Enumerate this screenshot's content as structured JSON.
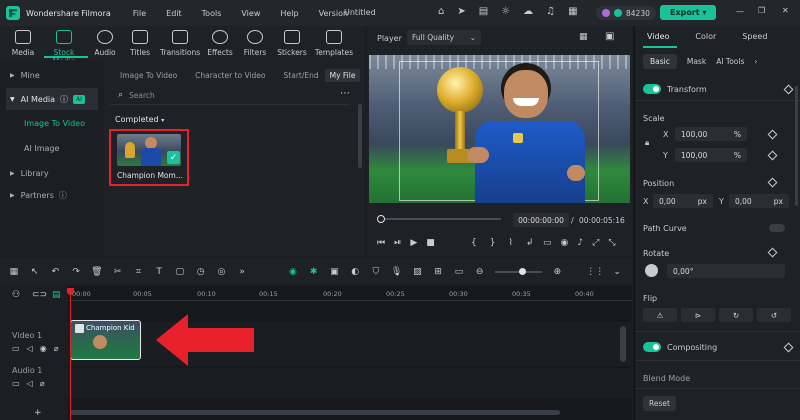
{
  "app": {
    "name": "Wondershare Filmora",
    "document": "Untitled",
    "credits": "84230",
    "export_label": "Export",
    "menu": [
      "File",
      "Edit",
      "Tools",
      "View",
      "Help",
      "Version"
    ]
  },
  "media_tabs": [
    {
      "label": "Media",
      "icon": "media-icon"
    },
    {
      "label": "Stock Media",
      "icon": "stock-media-icon"
    },
    {
      "label": "Audio",
      "icon": "audio-icon"
    },
    {
      "label": "Titles",
      "icon": "titles-icon"
    },
    {
      "label": "Transitions",
      "icon": "transitions-icon"
    },
    {
      "label": "Effects",
      "icon": "effects-icon"
    },
    {
      "label": "Filters",
      "icon": "filters-icon"
    },
    {
      "label": "Stickers",
      "icon": "stickers-icon"
    },
    {
      "label": "Templates",
      "icon": "templates-icon"
    }
  ],
  "sidebar": {
    "mine": "Mine",
    "ai_media": "AI Media",
    "ai_badge": "AI",
    "image_to_video": "Image To Video",
    "ai_image": "AI Image",
    "library": "Library",
    "partners": "Partners"
  },
  "ai_tabs": [
    "Image To Video",
    "Character to Video",
    "Start/End",
    "My File"
  ],
  "search_placeholder": "Search",
  "completed_label": "Completed",
  "media_item": {
    "name": "Champion Mom..."
  },
  "player": {
    "label": "Player",
    "quality": "Full Quality",
    "current_time": "00:00:00:00",
    "separator": "/",
    "total_time": "00:00:05:16"
  },
  "timeline": {
    "ruler": [
      "00:00",
      "00:05",
      "00:10",
      "00:15",
      "00:20",
      "00:25",
      "00:30",
      "00:35",
      "00:40"
    ],
    "video_track": "Video 1",
    "audio_track": "Audio 1",
    "clip_label": "Champion Kid"
  },
  "right": {
    "tabs": [
      "Video",
      "Color",
      "Speed"
    ],
    "subtabs": [
      "Basic",
      "Mask",
      "AI Tools"
    ],
    "transform": "Transform",
    "scale": "Scale",
    "x_label": "X",
    "y_label": "Y",
    "scale_x": "100,00",
    "scale_y": "100,00",
    "pct": "%",
    "position": "Position",
    "pos_x": "0,00",
    "pos_y": "0,00",
    "px": "px",
    "path_curve": "Path Curve",
    "rotate": "Rotate",
    "rotate_val": "0,00°",
    "flip": "Flip",
    "compositing": "Compositing",
    "blend_mode": "Blend Mode",
    "reset": "Reset"
  },
  "colors": {
    "accent": "#19c39a",
    "arrow": "#e8202a",
    "highlight": "#e8202a"
  }
}
